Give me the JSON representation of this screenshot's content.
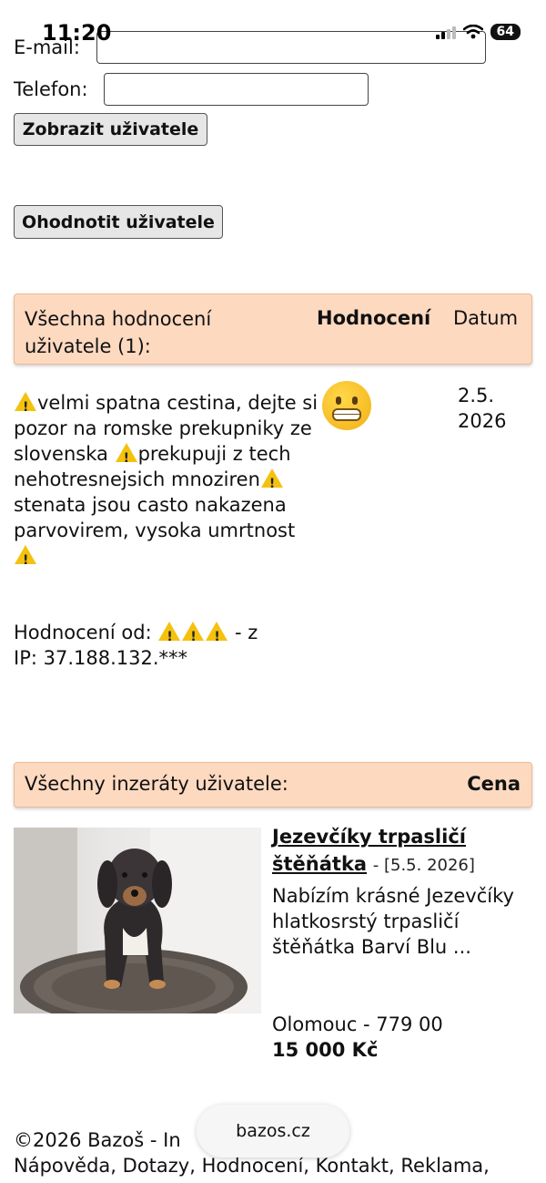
{
  "status_bar": {
    "time": "11:20",
    "battery": "64"
  },
  "form": {
    "email_label": "E-mail:",
    "phone_label": "Telefon:",
    "show_user_button": "Zobrazit uživatele",
    "rate_user_button": "Ohodnotit uživatele"
  },
  "ratings": {
    "header_title": "Všechna hodnocení uživatele (1):",
    "header_rating": "Hodnocení",
    "header_date": "Datum",
    "review": {
      "part1": "velmi spatna cestina, dejte si pozor na romske prekupniky ze slovenska",
      "part2": "prekupuji z tech nehotresnejsich mnoziren",
      "part3": "stenata jsou casto nakazena parvovirem, vysoka umrtnost",
      "rating_icon": "grimacing-face-emoji",
      "date": "2.5. 2026",
      "from_label": "Hodnocení od:",
      "from_suffix": "- z",
      "ip": "IP: 37.188.132.***"
    }
  },
  "listings": {
    "header_title": "Všechny inzeráty uživatele:",
    "header_price": "Cena",
    "items": [
      {
        "title": "Jezevčíky trpasličí štěňátka",
        "date": "- [5.5. 2026]",
        "description": "Nabízím krásné Jezevčíky hlatkosrstý trpasličí štěňátka Barví Blu ...",
        "location": "Olomouc - 779 00",
        "price": "15 000 Kč"
      }
    ]
  },
  "footer": {
    "copyright": "©2026 Bazoš - In",
    "links": "Nápověda, Dotazy, Hodnocení, Kontakt, Reklama,"
  },
  "browser": {
    "domain": "bazos.cz"
  }
}
